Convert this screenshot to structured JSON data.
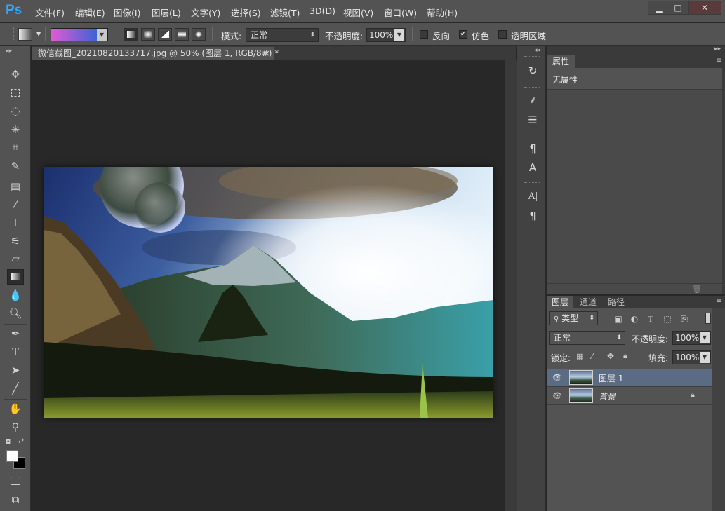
{
  "app": {
    "logo": "Ps"
  },
  "menu": [
    "文件(F)",
    "编辑(E)",
    "图像(I)",
    "图层(L)",
    "文字(Y)",
    "选择(S)",
    "滤镜(T)",
    "3D(D)",
    "视图(V)",
    "窗口(W)",
    "帮助(H)"
  ],
  "window_controls": {
    "minimize": "▁",
    "maximize": "□",
    "close": "✕"
  },
  "options": {
    "mode_label": "模式:",
    "mode_value": "正常",
    "opacity_label": "不透明度:",
    "opacity_value": "100%",
    "reverse_label": "反向",
    "reverse_checked": false,
    "dither_label": "仿色",
    "dither_checked": true,
    "transparency_label": "透明区域",
    "transparency_checked": false,
    "gradient_colors": [
      "#e25ad2",
      "#3a64d6"
    ]
  },
  "document": {
    "tab_title": "微信截图_20210820133717.jpg @ 50% (图层 1, RGB/8#) *",
    "close": "×"
  },
  "properties": {
    "tab": "属性",
    "empty_text": "无属性"
  },
  "layers_panel": {
    "tabs": [
      "图层",
      "通道",
      "路径"
    ],
    "filter_kind": "类型",
    "blend_mode": "正常",
    "opacity_label": "不透明度:",
    "opacity_value": "100%",
    "lock_label": "锁定:",
    "fill_label": "填充:",
    "fill_value": "100%",
    "layers": [
      {
        "name": "图层 1",
        "selected": true,
        "locked": false
      },
      {
        "name": "背景",
        "selected": false,
        "locked": true
      }
    ]
  },
  "colors": {
    "foreground": "#ffffff",
    "background": "#000000"
  }
}
